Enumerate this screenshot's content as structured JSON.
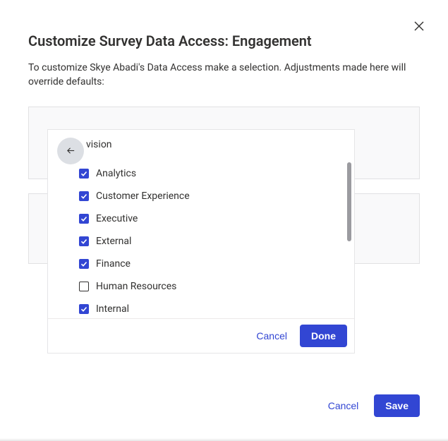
{
  "dialog": {
    "title": "Customize Survey Data Access: Engagement",
    "description": "To customize Skye Abadi's Data Access make a selection. Adjustments made here will override defaults:"
  },
  "dropdown": {
    "header_label": "vision",
    "options": [
      {
        "label": "Analytics",
        "checked": true
      },
      {
        "label": "Customer Experience",
        "checked": true
      },
      {
        "label": "Executive",
        "checked": true
      },
      {
        "label": "External",
        "checked": true
      },
      {
        "label": "Finance",
        "checked": true
      },
      {
        "label": "Human Resources",
        "checked": false
      },
      {
        "label": "Internal",
        "checked": true
      }
    ],
    "cancel_label": "Cancel",
    "done_label": "Done"
  },
  "footer": {
    "cancel_label": "Cancel",
    "save_label": "Save"
  }
}
